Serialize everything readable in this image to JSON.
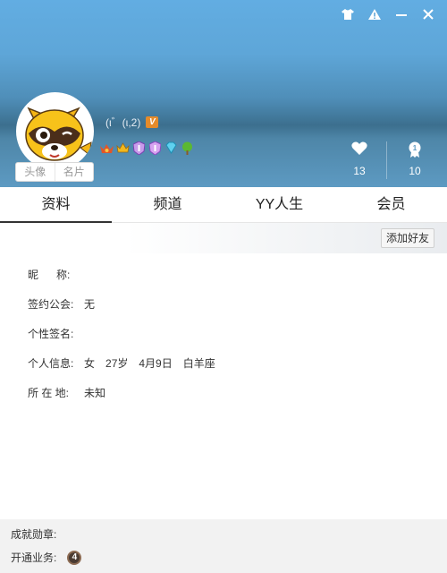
{
  "header": {
    "nickname": "(ι゛(ι,2)",
    "vip_level": "V",
    "avatar_tabs": [
      "头像",
      "名片"
    ],
    "stats": {
      "likes": "13",
      "rank": "10"
    },
    "medals": [
      "crown-wings-medal",
      "crown-medal",
      "purple-shield-medal",
      "purple-shield-medal-2",
      "diamond-medal",
      "tree-medal"
    ]
  },
  "tabs": [
    {
      "label": "资料"
    },
    {
      "label": "频道"
    },
    {
      "label": "YY人生"
    },
    {
      "label": "会员"
    }
  ],
  "toolbar": {
    "add_friend_label": "添加好友"
  },
  "profile": {
    "nickname_label": "昵      称:",
    "guild_label": "签约公会:",
    "guild_value": "无",
    "signature_label": "个性签名:",
    "personal_label": "个人信息:",
    "gender": "女",
    "age": "27岁",
    "birthday": "4月9日",
    "zodiac": "白羊座",
    "location_label": "所 在 地:",
    "location_value": "未知"
  },
  "footer": {
    "achievements_label": "成就勋章:",
    "services_label": "开通业务:",
    "service_badge": "4"
  },
  "colors": {
    "accent": "#5ea6d8",
    "vip": "#e58b2a"
  }
}
